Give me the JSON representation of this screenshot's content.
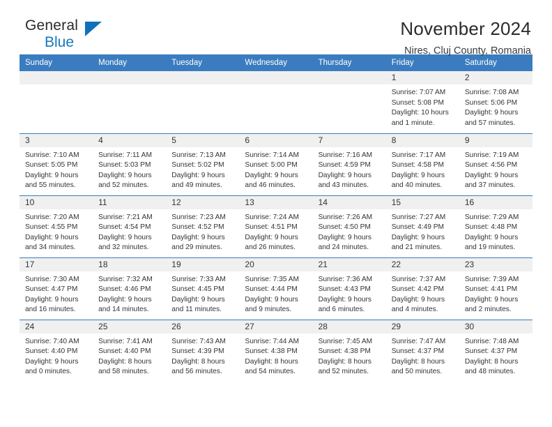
{
  "brand": {
    "name_top": "General",
    "name_bottom": "Blue",
    "triangle_icon": "triangle-icon",
    "color_dark": "#2b2b2b",
    "color_blue": "#1479bd"
  },
  "header": {
    "title": "November 2024",
    "subtitle": "Nires, Cluj County, Romania"
  },
  "theme": {
    "header_bg": "#3a7cbf",
    "daynum_bg": "#f0f0f0",
    "text": "#333333",
    "page_bg": "#ffffff"
  },
  "weekdays": [
    "Sunday",
    "Monday",
    "Tuesday",
    "Wednesday",
    "Thursday",
    "Friday",
    "Saturday"
  ],
  "labels": {
    "sunrise": "Sunrise:",
    "sunset": "Sunset:",
    "daylight": "Daylight:"
  },
  "weeks": [
    [
      {
        "day": "",
        "empty": true
      },
      {
        "day": "",
        "empty": true
      },
      {
        "day": "",
        "empty": true
      },
      {
        "day": "",
        "empty": true
      },
      {
        "day": "",
        "empty": true
      },
      {
        "day": "1",
        "sunrise": "Sunrise: 7:07 AM",
        "sunset": "Sunset: 5:08 PM",
        "daylight": "Daylight: 10 hours and 1 minute."
      },
      {
        "day": "2",
        "sunrise": "Sunrise: 7:08 AM",
        "sunset": "Sunset: 5:06 PM",
        "daylight": "Daylight: 9 hours and 57 minutes."
      }
    ],
    [
      {
        "day": "3",
        "sunrise": "Sunrise: 7:10 AM",
        "sunset": "Sunset: 5:05 PM",
        "daylight": "Daylight: 9 hours and 55 minutes."
      },
      {
        "day": "4",
        "sunrise": "Sunrise: 7:11 AM",
        "sunset": "Sunset: 5:03 PM",
        "daylight": "Daylight: 9 hours and 52 minutes."
      },
      {
        "day": "5",
        "sunrise": "Sunrise: 7:13 AM",
        "sunset": "Sunset: 5:02 PM",
        "daylight": "Daylight: 9 hours and 49 minutes."
      },
      {
        "day": "6",
        "sunrise": "Sunrise: 7:14 AM",
        "sunset": "Sunset: 5:00 PM",
        "daylight": "Daylight: 9 hours and 46 minutes."
      },
      {
        "day": "7",
        "sunrise": "Sunrise: 7:16 AM",
        "sunset": "Sunset: 4:59 PM",
        "daylight": "Daylight: 9 hours and 43 minutes."
      },
      {
        "day": "8",
        "sunrise": "Sunrise: 7:17 AM",
        "sunset": "Sunset: 4:58 PM",
        "daylight": "Daylight: 9 hours and 40 minutes."
      },
      {
        "day": "9",
        "sunrise": "Sunrise: 7:19 AM",
        "sunset": "Sunset: 4:56 PM",
        "daylight": "Daylight: 9 hours and 37 minutes."
      }
    ],
    [
      {
        "day": "10",
        "sunrise": "Sunrise: 7:20 AM",
        "sunset": "Sunset: 4:55 PM",
        "daylight": "Daylight: 9 hours and 34 minutes."
      },
      {
        "day": "11",
        "sunrise": "Sunrise: 7:21 AM",
        "sunset": "Sunset: 4:54 PM",
        "daylight": "Daylight: 9 hours and 32 minutes."
      },
      {
        "day": "12",
        "sunrise": "Sunrise: 7:23 AM",
        "sunset": "Sunset: 4:52 PM",
        "daylight": "Daylight: 9 hours and 29 minutes."
      },
      {
        "day": "13",
        "sunrise": "Sunrise: 7:24 AM",
        "sunset": "Sunset: 4:51 PM",
        "daylight": "Daylight: 9 hours and 26 minutes."
      },
      {
        "day": "14",
        "sunrise": "Sunrise: 7:26 AM",
        "sunset": "Sunset: 4:50 PM",
        "daylight": "Daylight: 9 hours and 24 minutes."
      },
      {
        "day": "15",
        "sunrise": "Sunrise: 7:27 AM",
        "sunset": "Sunset: 4:49 PM",
        "daylight": "Daylight: 9 hours and 21 minutes."
      },
      {
        "day": "16",
        "sunrise": "Sunrise: 7:29 AM",
        "sunset": "Sunset: 4:48 PM",
        "daylight": "Daylight: 9 hours and 19 minutes."
      }
    ],
    [
      {
        "day": "17",
        "sunrise": "Sunrise: 7:30 AM",
        "sunset": "Sunset: 4:47 PM",
        "daylight": "Daylight: 9 hours and 16 minutes."
      },
      {
        "day": "18",
        "sunrise": "Sunrise: 7:32 AM",
        "sunset": "Sunset: 4:46 PM",
        "daylight": "Daylight: 9 hours and 14 minutes."
      },
      {
        "day": "19",
        "sunrise": "Sunrise: 7:33 AM",
        "sunset": "Sunset: 4:45 PM",
        "daylight": "Daylight: 9 hours and 11 minutes."
      },
      {
        "day": "20",
        "sunrise": "Sunrise: 7:35 AM",
        "sunset": "Sunset: 4:44 PM",
        "daylight": "Daylight: 9 hours and 9 minutes."
      },
      {
        "day": "21",
        "sunrise": "Sunrise: 7:36 AM",
        "sunset": "Sunset: 4:43 PM",
        "daylight": "Daylight: 9 hours and 6 minutes."
      },
      {
        "day": "22",
        "sunrise": "Sunrise: 7:37 AM",
        "sunset": "Sunset: 4:42 PM",
        "daylight": "Daylight: 9 hours and 4 minutes."
      },
      {
        "day": "23",
        "sunrise": "Sunrise: 7:39 AM",
        "sunset": "Sunset: 4:41 PM",
        "daylight": "Daylight: 9 hours and 2 minutes."
      }
    ],
    [
      {
        "day": "24",
        "sunrise": "Sunrise: 7:40 AM",
        "sunset": "Sunset: 4:40 PM",
        "daylight": "Daylight: 9 hours and 0 minutes."
      },
      {
        "day": "25",
        "sunrise": "Sunrise: 7:41 AM",
        "sunset": "Sunset: 4:40 PM",
        "daylight": "Daylight: 8 hours and 58 minutes."
      },
      {
        "day": "26",
        "sunrise": "Sunrise: 7:43 AM",
        "sunset": "Sunset: 4:39 PM",
        "daylight": "Daylight: 8 hours and 56 minutes."
      },
      {
        "day": "27",
        "sunrise": "Sunrise: 7:44 AM",
        "sunset": "Sunset: 4:38 PM",
        "daylight": "Daylight: 8 hours and 54 minutes."
      },
      {
        "day": "28",
        "sunrise": "Sunrise: 7:45 AM",
        "sunset": "Sunset: 4:38 PM",
        "daylight": "Daylight: 8 hours and 52 minutes."
      },
      {
        "day": "29",
        "sunrise": "Sunrise: 7:47 AM",
        "sunset": "Sunset: 4:37 PM",
        "daylight": "Daylight: 8 hours and 50 minutes."
      },
      {
        "day": "30",
        "sunrise": "Sunrise: 7:48 AM",
        "sunset": "Sunset: 4:37 PM",
        "daylight": "Daylight: 8 hours and 48 minutes."
      }
    ]
  ]
}
